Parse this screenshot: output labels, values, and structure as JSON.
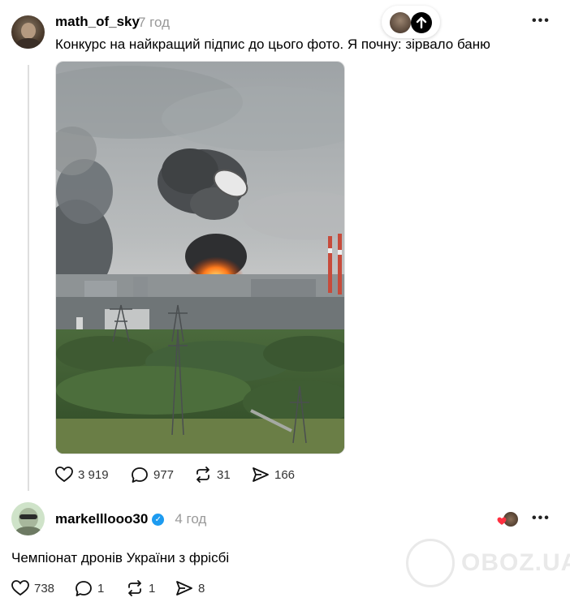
{
  "post1": {
    "username": "math_of_sky",
    "time": "7 год",
    "text": "Конкурс на найкращий підпис до цього фото. Я почну: зірвало баню",
    "likes": "3 919",
    "comments": "977",
    "reposts": "31",
    "shares": "166"
  },
  "post2": {
    "username": "markelllooo30",
    "time": "4 год",
    "text": "Чемпіонат дронів України з фрісбі",
    "likes": "738",
    "comments": "1",
    "reposts": "1",
    "shares": "8"
  },
  "watermark": "OBOZ.UA",
  "icons": {
    "more": "more-horizontal-icon",
    "like": "heart-icon",
    "comment": "comment-bubble-icon",
    "repost": "repost-icon",
    "share": "send-icon",
    "verified": "verified-badge-icon",
    "scroll_up": "arrow-up-icon"
  }
}
